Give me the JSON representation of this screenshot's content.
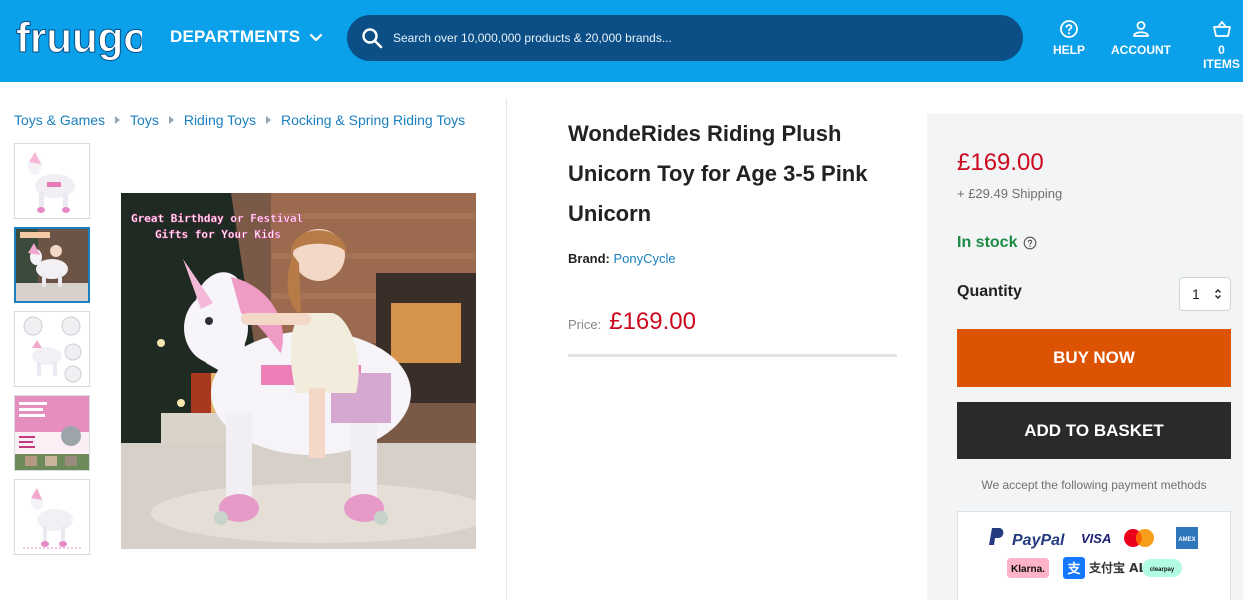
{
  "header": {
    "logo_text": "fruugo",
    "departments_label": "DEPARTMENTS",
    "search_placeholder": "Search over 10,000,000 products & 20,000 brands...",
    "help_label": "HELP",
    "account_label": "ACCOUNT",
    "basket_label": "0 ITEMS"
  },
  "breadcrumb": [
    "Toys & Games",
    "Toys",
    "Riding Toys",
    "Rocking & Spring Riding Toys"
  ],
  "gallery": {
    "main_image_caption_line1": "Great Birthday or Festival",
    "main_image_caption_line2": "Gifts for Your Kids",
    "thumbnail_count": 5,
    "active_thumbnail_index": 1
  },
  "product": {
    "title": "WondeRides Riding Plush Unicorn Toy for Age 3-5 Pink Unicorn",
    "brand_label": "Brand:",
    "brand_name": "PonyCycle",
    "price_label": "Price:",
    "price": "£169.00"
  },
  "buybox": {
    "price": "£169.00",
    "shipping": "+ £29.49 Shipping",
    "stock": "In stock",
    "quantity_label": "Quantity",
    "quantity_value": "1",
    "buy_now": "BUY NOW",
    "add_to_basket": "ADD TO BASKET",
    "payments_text": "We accept the following payment methods",
    "payment_methods": [
      "PayPal",
      "VISA",
      "Mastercard",
      "American Express",
      "Klarna.",
      "支付宝 ALIPAY",
      "clearpay"
    ]
  },
  "colors": {
    "header_bg": "#0aa0ea",
    "search_bg": "#0b4f86",
    "price_red": "#cc0a1f",
    "stock_green": "#1b8b43",
    "buy_now_orange": "#dc5304",
    "basket_dark": "#2a2a2a",
    "link_blue": "#1a7fbf"
  }
}
